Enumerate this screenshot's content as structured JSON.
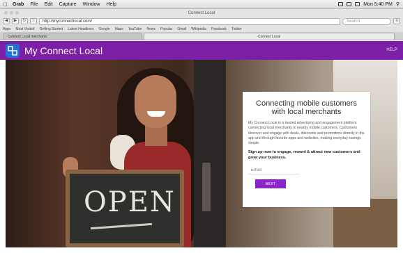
{
  "os_menubar": {
    "apple": "",
    "items": [
      "Grab",
      "File",
      "Edit",
      "Capture",
      "Window",
      "Help"
    ],
    "right_status": "Mon 5:40 PM"
  },
  "browser": {
    "window_title": "Connect Local",
    "url": "http://myconnectlocal.com/",
    "search_placeholder": "Search",
    "bookmarks": [
      "Apps",
      "Most Visited",
      "Getting Started",
      "Latest Headlines",
      "Google",
      "Maps",
      "YouTube",
      "News",
      "Popular",
      "Gmail",
      "Wikipedia",
      "Facebook",
      "Twitter"
    ],
    "tabs": [
      {
        "label": "Connect Local merchants",
        "active": false
      },
      {
        "label": "Connect Local",
        "active": true
      }
    ]
  },
  "site": {
    "brand": "My Connect Local",
    "header_right": "HELP",
    "sign_word": "OPEN",
    "card": {
      "title": "Connecting mobile customers with local merchants",
      "description": "My Connect Local is a trusted advertising and engagement platform connecting local merchants to nearby mobile customers. Customers discover and engage with deals, discounts and promotions directly in the app and through favorite apps and websites, making everyday savings simple.",
      "cta": "Sign up now to engage, reward & attract new customers and grow your business.",
      "email_placeholder": "Email",
      "next_label": "NEXT"
    }
  },
  "colors": {
    "header_purple": "#7d1fa6",
    "button_purple": "#8a25c9",
    "logo_blue": "#1f72d8"
  }
}
